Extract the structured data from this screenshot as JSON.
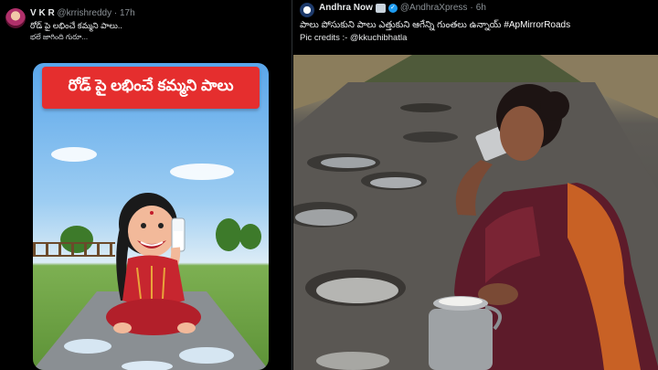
{
  "left_post": {
    "author_name": "V K R",
    "handle": "@krrishreddy",
    "separator": "·",
    "time": "17h",
    "text_line1": "రోడ్ పై లభించే కమ్మని పాలు..",
    "text_line2": "భలే జాగింది గురూ...",
    "image": {
      "banner_text": "రోడ్ పై లభించే కమ్మని పాలు"
    }
  },
  "right_post": {
    "author_name": "Andhra Now",
    "handle": "@AndhraXpress",
    "separator": "·",
    "time": "6h",
    "text_line1": "పాలు పోసుకుని పాలు ఎత్తుకుని ఆగేన్ని గుంతలు ఉన్నాయ్",
    "hashtag": "#ApMirrorRoads",
    "text_line2": "Pic credits :- @kkuchibhatla"
  },
  "colors": {
    "background": "#000000",
    "banner_red": "#e52e2e",
    "verified_blue": "#1d9bf0",
    "muted_text": "#8b9196"
  }
}
